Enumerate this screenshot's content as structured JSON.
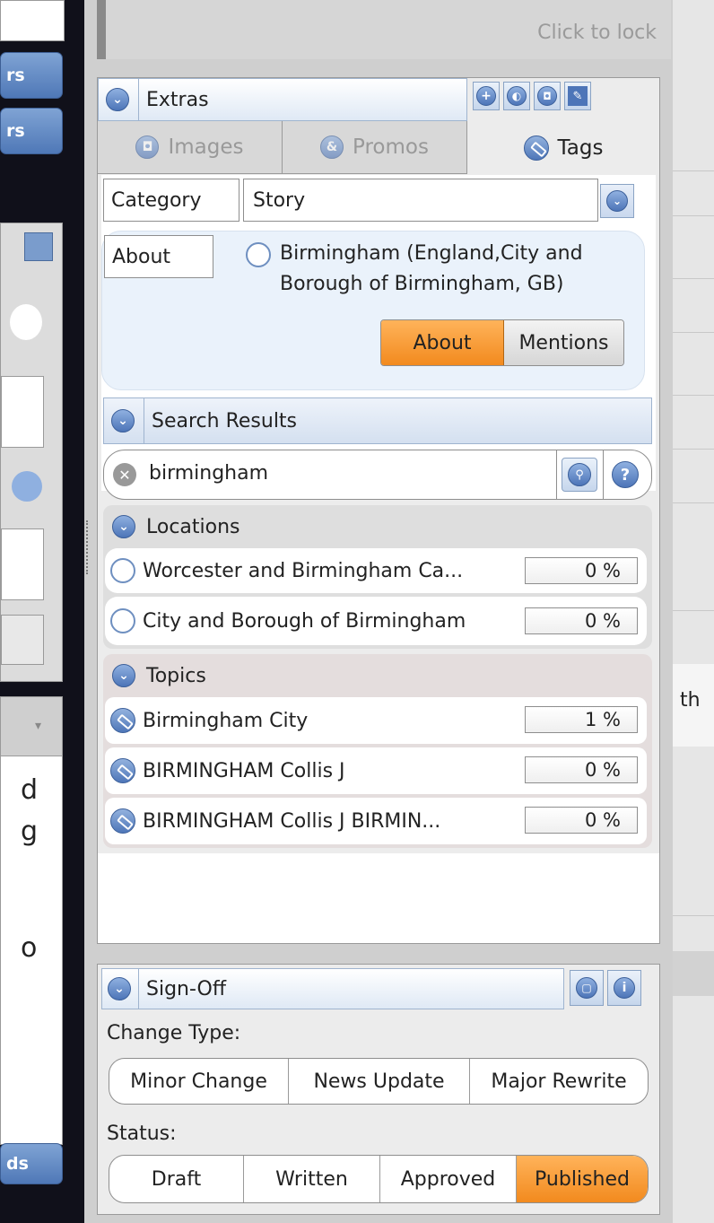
{
  "top_panel": {
    "click_to_lock": "Click to lock"
  },
  "left_strip": {
    "btn1": "rs",
    "btn2": "rs",
    "letters": [
      "d",
      "g",
      "o"
    ],
    "bottom_btn": "ds"
  },
  "right_strip": {
    "fragment": "th"
  },
  "extras": {
    "title": "Extras",
    "tabs": [
      {
        "label": "Images",
        "icon": "camera-icon",
        "active": false
      },
      {
        "label": "Promos",
        "icon": "ampersand-icon",
        "active": false
      },
      {
        "label": "Tags",
        "icon": "tag-icon",
        "active": true
      }
    ],
    "header_icons": [
      "add-icon",
      "globe-icon",
      "camera-icon",
      "edit-icon"
    ],
    "category": {
      "label": "Category",
      "value": "Story"
    },
    "about": {
      "label": "About",
      "tag_line1": "Birmingham (England,City and",
      "tag_line2": "Borough of Birmingham, GB)",
      "toggle": {
        "about": "About",
        "mentions": "Mentions",
        "selected": "About"
      }
    }
  },
  "search": {
    "title": "Search Results",
    "query": "birmingham",
    "locations": {
      "title": "Locations",
      "items": [
        {
          "name": "Worcester and Birmingham Ca...",
          "score": "0 %"
        },
        {
          "name": "City and Borough of Birmingham",
          "score": "0 %"
        }
      ]
    },
    "topics": {
      "title": "Topics",
      "items": [
        {
          "name": "Birmingham City",
          "score": "1 %"
        },
        {
          "name": "BIRMINGHAM Collis J",
          "score": "0 %"
        },
        {
          "name": "BIRMINGHAM Collis J BIRMIN...",
          "score": "0 %"
        }
      ]
    }
  },
  "signoff": {
    "title": "Sign-Off",
    "change_type_label": "Change Type:",
    "change_types": [
      "Minor Change",
      "News Update",
      "Major Rewrite"
    ],
    "status_label": "Status:",
    "statuses": [
      "Draft",
      "Written",
      "Approved",
      "Published"
    ],
    "selected_status": "Published"
  },
  "colors": {
    "accent_orange": "#f28a1e",
    "header_blue": "#dfe9f5",
    "icon_blue": "#4d75b8"
  }
}
